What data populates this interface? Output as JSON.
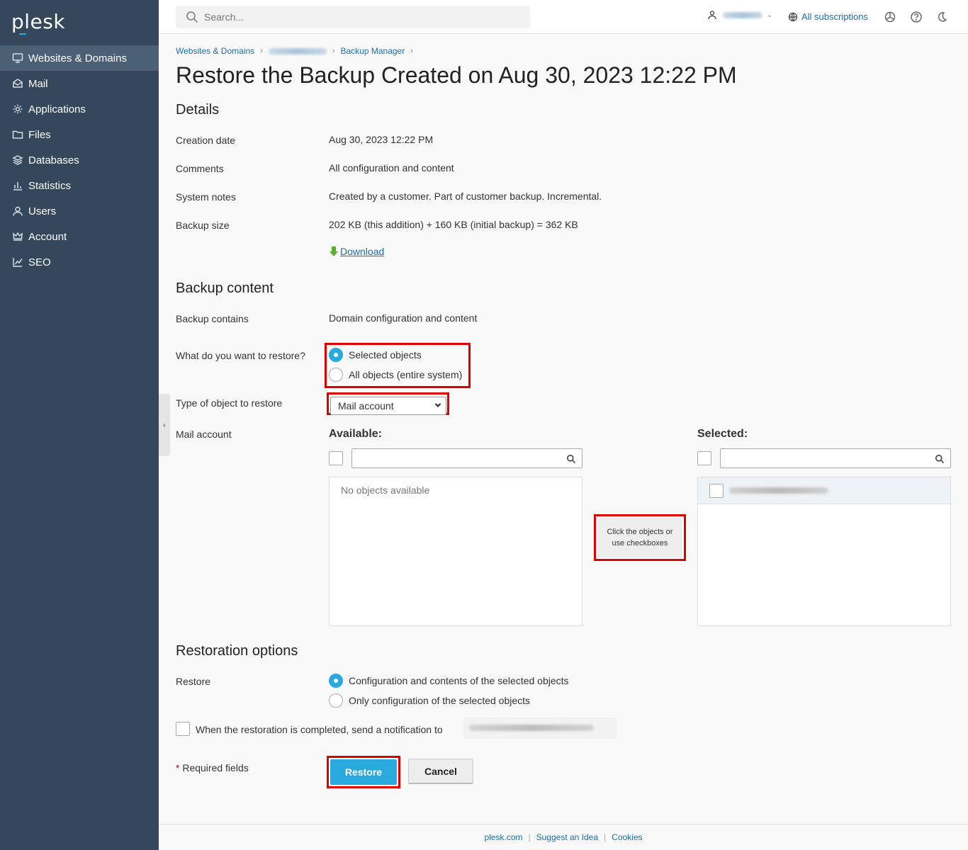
{
  "brand": "plesk",
  "colors": {
    "accent": "#28aade",
    "sidebar": "#35475b",
    "link": "#1a6ea8",
    "highlight": "#e00000"
  },
  "sidebar": {
    "items": [
      {
        "label": "Websites & Domains",
        "icon": "monitor-icon",
        "active": true
      },
      {
        "label": "Mail",
        "icon": "mail-icon"
      },
      {
        "label": "Applications",
        "icon": "gear-icon"
      },
      {
        "label": "Files",
        "icon": "folder-icon"
      },
      {
        "label": "Databases",
        "icon": "database-icon"
      },
      {
        "label": "Statistics",
        "icon": "bar-chart-icon"
      },
      {
        "label": "Users",
        "icon": "user-icon"
      },
      {
        "label": "Account",
        "icon": "crown-icon"
      },
      {
        "label": "SEO",
        "icon": "seo-chart-icon"
      }
    ]
  },
  "header": {
    "search_placeholder": "Search...",
    "subscriptions_label": "All subscriptions"
  },
  "breadcrumb": {
    "item1": "Websites & Domains",
    "item3": "Backup Manager"
  },
  "page_title": "Restore the Backup Created on Aug 30, 2023 12:22 PM",
  "details": {
    "title": "Details",
    "creation_date_label": "Creation date",
    "creation_date": "Aug 30, 2023 12:22 PM",
    "comments_label": "Comments",
    "comments": "All configuration and content",
    "system_notes_label": "System notes",
    "system_notes": "Created by a customer. Part of customer backup. Incremental.",
    "backup_size_label": "Backup size",
    "backup_size": "202 KB (this addition) + 160 KB (initial backup) = 362 KB",
    "download_label": "Download"
  },
  "backup_content": {
    "title": "Backup content",
    "contains_label": "Backup contains",
    "contains": "Domain configuration and content",
    "restore_what_label": "What do you want to restore?",
    "option_selected": "Selected objects",
    "option_all": "All objects (entire system)",
    "type_label": "Type of object to restore",
    "type_value": "Mail account",
    "mail_account_label": "Mail account",
    "available_label": "Available:",
    "selected_label": "Selected:",
    "no_objects": "No objects available",
    "hint": "Click the objects or use checkboxes"
  },
  "restoration": {
    "title": "Restoration options",
    "restore_label": "Restore",
    "option_config_content": "Configuration and contents of the selected objects",
    "option_config_only": "Only configuration of the selected objects",
    "notify_label": "When the restoration is completed, send a notification to"
  },
  "form": {
    "required_star": "*",
    "required_text": " Required fields",
    "restore_button": "Restore",
    "cancel_button": "Cancel"
  },
  "footer": {
    "link1": "plesk.com",
    "link2": "Suggest an Idea",
    "link3": "Cookies"
  }
}
